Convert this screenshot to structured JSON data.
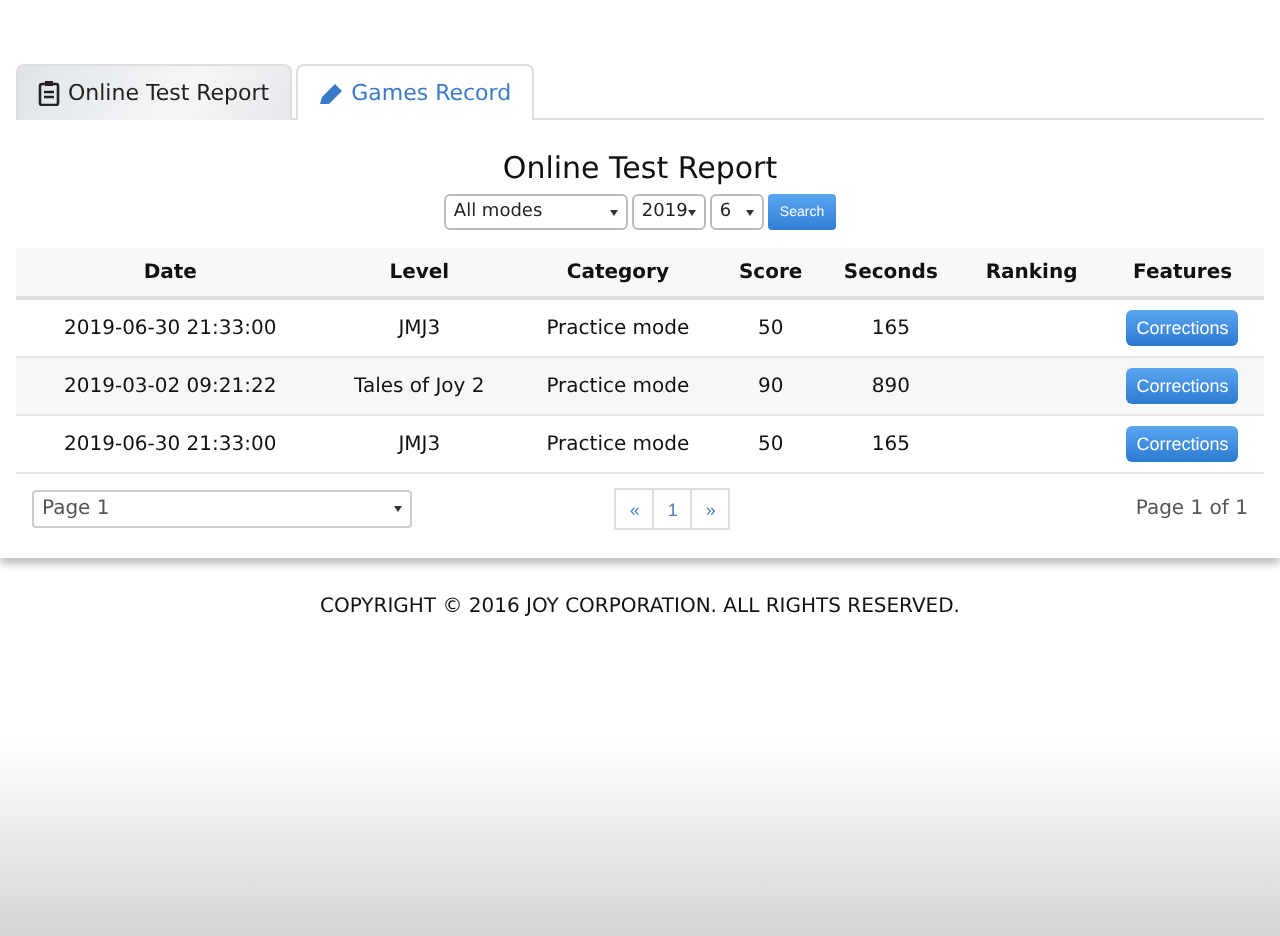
{
  "tabs": [
    {
      "label": "Online Test Report",
      "selected": true
    },
    {
      "label": "Games Record",
      "selected": false
    }
  ],
  "title": "Online Test Report",
  "filters": {
    "mode": "All modes",
    "year": "2019",
    "month": "6",
    "search_button": "Search"
  },
  "table": {
    "columns": [
      "Date",
      "Level",
      "Category",
      "Score",
      "Seconds",
      "Ranking",
      "Features"
    ],
    "rows": [
      {
        "cells": [
          "2019-06-30 21:33:00",
          "JMJ3",
          "Practice mode",
          "50",
          "165",
          ""
        ],
        "action": "Corrections"
      },
      {
        "cells": [
          "2019-03-02 09:21:22",
          "Tales of Joy 2",
          "Practice mode",
          "90",
          "890",
          ""
        ],
        "action": "Corrections"
      },
      {
        "cells": [
          "2019-06-30 21:33:00",
          "JMJ3",
          "Practice mode",
          "50",
          "165",
          ""
        ],
        "action": "Corrections"
      }
    ]
  },
  "pagination": {
    "page_select": "Page 1",
    "prev": "«",
    "pages": [
      "1"
    ],
    "next": "»",
    "summary": "Page 1 of 1"
  },
  "footer": "COPYRIGHT © 2016 JOY CORPORATION. ALL RIGHTS RESERVED."
}
